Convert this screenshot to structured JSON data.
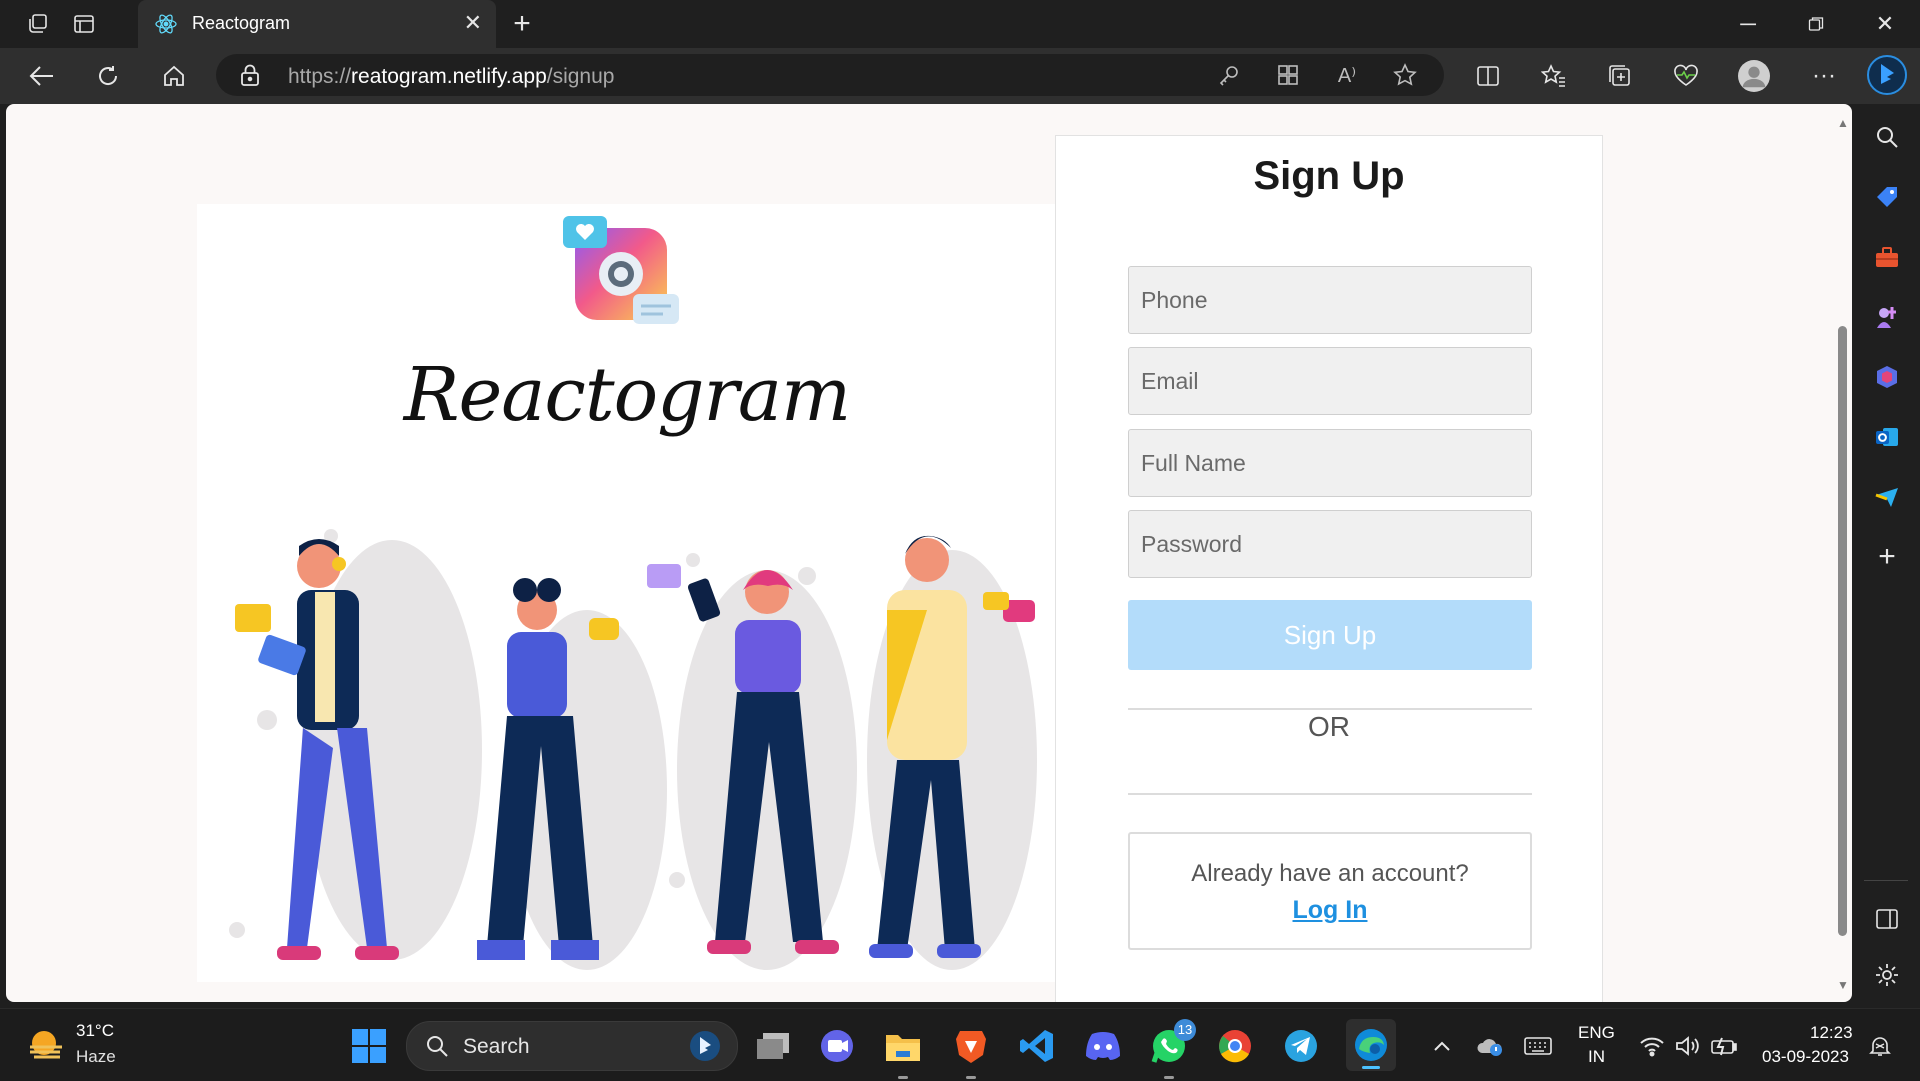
{
  "browser": {
    "tab_title": "Reactogram",
    "url_scheme": "https://",
    "url_host": "reatogram.netlify.app",
    "url_path": "/signup"
  },
  "page": {
    "brand_name": "Reactogram",
    "form_title": "Sign Up",
    "phone_placeholder": "Phone",
    "email_placeholder": "Email",
    "fullname_placeholder": "Full Name",
    "password_placeholder": "Password",
    "submit_label": "Sign Up",
    "divider_text": "OR",
    "login_prompt": "Already have an account?",
    "login_link": "Log In",
    "accent_color": "#1e90e0",
    "button_color": "#b3dcfa"
  },
  "taskbar": {
    "weather_temp": "31°C",
    "weather_desc": "Haze",
    "search_label": "Search",
    "whatsapp_badge": "13",
    "lang_line1": "ENG",
    "lang_line2": "IN",
    "time": "12:23",
    "date": "03-09-2023"
  },
  "icons": [
    "workspaces-icon",
    "tab-actions-icon",
    "react-favicon-icon",
    "close-tab-icon",
    "new-tab-icon",
    "back-icon",
    "refresh-icon",
    "home-icon",
    "lock-icon",
    "key-icon",
    "apps-icon",
    "read-aloud-icon",
    "favorite-star-icon",
    "split-screen-icon",
    "favorites-icon",
    "collections-icon",
    "health-icon",
    "profile-icon",
    "more-icon",
    "bing-icon",
    "search-icon",
    "shopping-tag-icon",
    "tools-icon",
    "games-icon",
    "office-icon",
    "outlook-icon",
    "send-icon",
    "add-icon",
    "sidebar-toggle-icon",
    "settings-icon"
  ]
}
